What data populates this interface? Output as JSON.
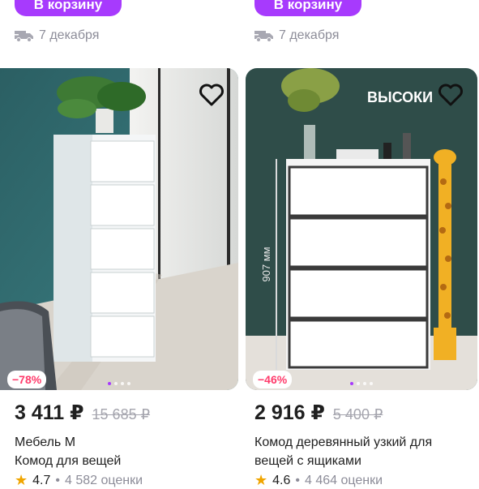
{
  "products": [
    {
      "cart_label": "В корзину",
      "delivery": "7 декабря",
      "discount": "−78%",
      "price": "3 411 ₽",
      "old_price": "15 685 ₽",
      "title_line1": "Мебель М",
      "title_line2": "Комод для вещей",
      "rating": "4.7",
      "reviews": "4 582 оценки",
      "photo_text": ""
    },
    {
      "cart_label": "В корзину",
      "delivery": "7 декабря",
      "discount": "−46%",
      "price": "2 916 ₽",
      "old_price": "5 400 ₽",
      "title_line1": "Комод деревянный узкий для",
      "title_line2": "вещей с ящиками",
      "rating": "4.6",
      "reviews": "4 464 оценки",
      "photo_text": "ВЫСОКИ",
      "height_label": "907 мм"
    }
  ],
  "icons": {
    "delivery": "truck-icon",
    "favorite": "heart-icon",
    "rating": "star-icon"
  },
  "colors": {
    "accent": "#a73afd",
    "discount": "#ff3b6b",
    "star": "#f0a500"
  }
}
